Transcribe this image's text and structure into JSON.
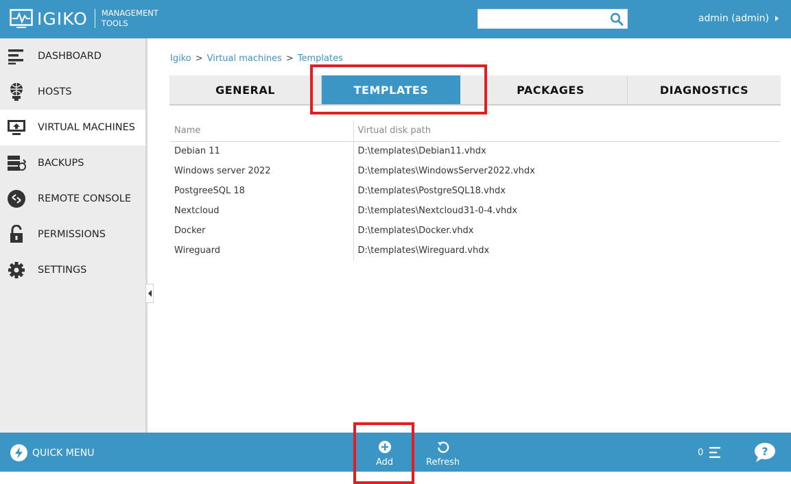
{
  "app": {
    "brand": "IGIKO",
    "brand_sub_line1": "MANAGEMENT",
    "brand_sub_line2": "TOOLS"
  },
  "header": {
    "search_placeholder": "",
    "user_label": "admin (admin)"
  },
  "sidebar": {
    "items": [
      {
        "label": "DASHBOARD",
        "icon": "dashboard-icon"
      },
      {
        "label": "HOSTS",
        "icon": "host-globe-icon"
      },
      {
        "label": "VIRTUAL MACHINES",
        "icon": "monitor-icon"
      },
      {
        "label": "BACKUPS",
        "icon": "backup-icon"
      },
      {
        "label": "REMOTE CONSOLE",
        "icon": "remote-console-icon"
      },
      {
        "label": "PERMISSIONS",
        "icon": "lock-icon"
      },
      {
        "label": "SETTINGS",
        "icon": "gear-icon"
      }
    ],
    "active_index": 2
  },
  "breadcrumb": {
    "items": [
      "Igiko",
      "Virtual machines",
      "Templates"
    ],
    "separator": ">"
  },
  "tabs": [
    "GENERAL",
    "TEMPLATES",
    "PACKAGES",
    "DIAGNOSTICS"
  ],
  "active_tab": "TEMPLATES",
  "table": {
    "columns": [
      "Name",
      "Virtual disk path"
    ],
    "rows": [
      [
        "Debian 11",
        "D:\\templates\\Debian11.vhdx"
      ],
      [
        "Windows server 2022",
        "D:\\templates\\WindowsServer2022.vhdx"
      ],
      [
        "PostgreeSQL 18",
        "D:\\templates\\PostgreSQL18.vhdx"
      ],
      [
        "Nextcloud",
        "D:\\templates\\Nextcloud31-0-4.vhdx"
      ],
      [
        "Docker",
        "D:\\templates\\Docker.vhdx"
      ],
      [
        "Wireguard",
        "D:\\templates\\Wireguard.vhdx"
      ]
    ]
  },
  "bottombar": {
    "quick_menu_label": "QUICK MENU",
    "add_label": "Add",
    "refresh_label": "Refresh",
    "task_count": "0"
  },
  "colors": {
    "accent": "#3b96c6",
    "highlight": "#e02020",
    "sidebar_bg": "#ececec"
  }
}
